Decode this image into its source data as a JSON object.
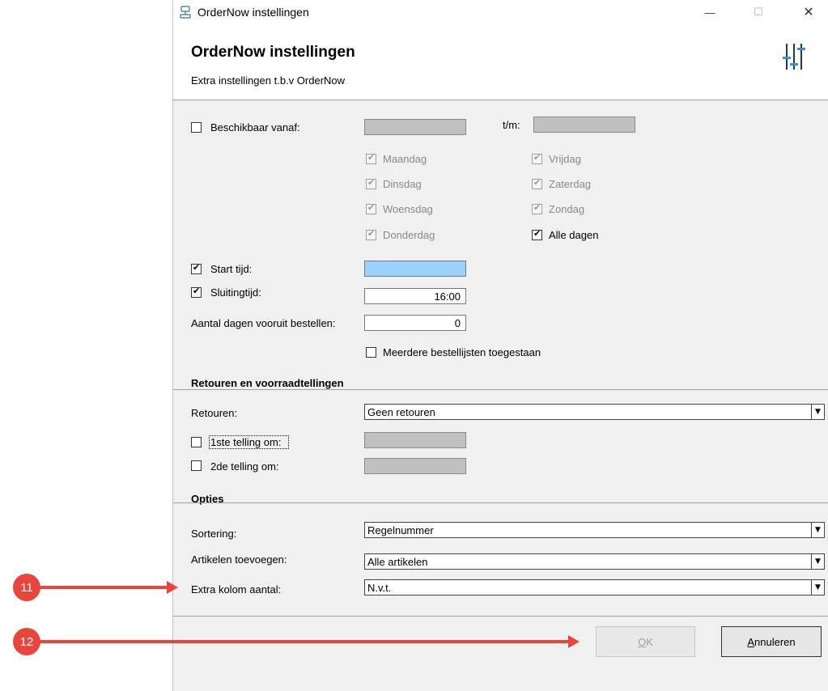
{
  "window": {
    "title": "OrderNow instellingen",
    "minimize_glyph": "—",
    "maximize_glyph": "☐",
    "close_glyph": "✕"
  },
  "header": {
    "title": "OrderNow instellingen",
    "subtitle": "Extra instellingen t.b.v OrderNow"
  },
  "availability": {
    "available_from_label": "Beschikbaar vanaf:",
    "available_from_checked": false,
    "from_value": "",
    "to_label": "t/m:",
    "to_value": "",
    "days": {
      "monday": "Maandag",
      "tuesday": "Dinsdag",
      "wednesday": "Woensdag",
      "thursday": "Donderdag",
      "friday": "Vrijdag",
      "saturday": "Zaterdag",
      "sunday": "Zondag",
      "all_days": "Alle dagen"
    },
    "start_time_label": "Start tijd:",
    "start_time_value": "",
    "closing_time_label": "Sluitingtijd:",
    "closing_time_value": "16:00",
    "days_ahead_label": "Aantal dagen vooruit bestellen:",
    "days_ahead_value": "0",
    "multiple_lists_label": "Meerdere bestellijsten toegestaan"
  },
  "returns": {
    "section_title": "Retouren en voorraadtellingen",
    "returns_label": "Retouren:",
    "returns_value": "Geen retouren",
    "first_count_label": "1ste telling om:",
    "first_count_value": "",
    "second_count_label": "2de telling om:",
    "second_count_value": ""
  },
  "options": {
    "section_title": "Opties",
    "sorting_label": "Sortering:",
    "sorting_value": "Regelnummer",
    "add_articles_label": "Artikelen toevoegen:",
    "add_articles_value": "Alle artikelen",
    "extra_column_label": "Extra kolom aantal:",
    "extra_column_value": "N.v.t."
  },
  "buttons": {
    "ok_hotkey": "O",
    "ok_rest": "K",
    "cancel_hotkey": "A",
    "cancel_rest": "nnuleren"
  },
  "annotations": {
    "badge_11": "11",
    "badge_12": "12",
    "color": "#e8463c"
  },
  "dropdown_glyph": "▼"
}
